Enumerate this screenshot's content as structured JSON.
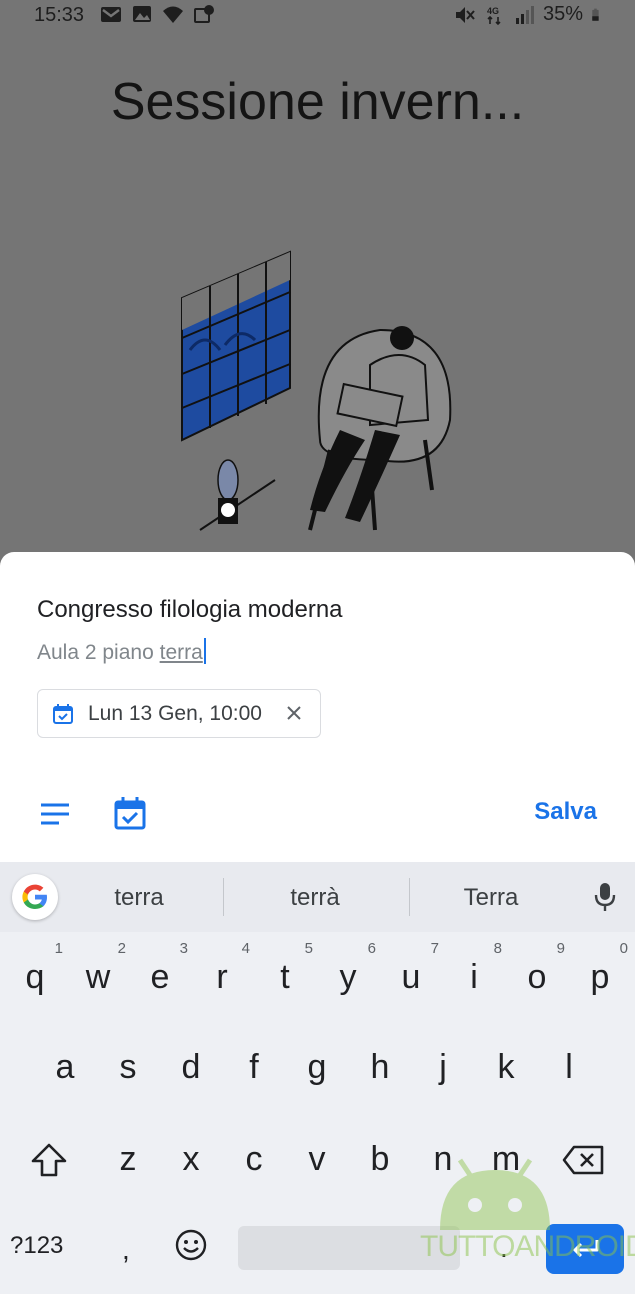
{
  "status_bar": {
    "time": "15:33",
    "battery": "35%",
    "network": "4G"
  },
  "background_app": {
    "title": "Sessione invern..."
  },
  "sheet": {
    "task_title": "Congresso filologia moderna",
    "details_prefix": "Aula 2 piano ",
    "details_underlined": "terra",
    "date_chip": "Lun 13 Gen, 10:00",
    "save_label": "Salva"
  },
  "keyboard": {
    "suggestions": [
      "terra",
      "terrà",
      "Terra"
    ],
    "row1": [
      {
        "key": "q",
        "hint": "1"
      },
      {
        "key": "w",
        "hint": "2"
      },
      {
        "key": "e",
        "hint": "3"
      },
      {
        "key": "r",
        "hint": "4"
      },
      {
        "key": "t",
        "hint": "5"
      },
      {
        "key": "y",
        "hint": "6"
      },
      {
        "key": "u",
        "hint": "7"
      },
      {
        "key": "i",
        "hint": "8"
      },
      {
        "key": "o",
        "hint": "9"
      },
      {
        "key": "p",
        "hint": "0"
      }
    ],
    "row2": [
      "a",
      "s",
      "d",
      "f",
      "g",
      "h",
      "j",
      "k",
      "l"
    ],
    "row3": [
      "z",
      "x",
      "c",
      "v",
      "b",
      "n",
      "m"
    ],
    "symbols_label": "?123",
    "comma": ",",
    "period": "."
  },
  "watermark": "TUTTOANDROID",
  "colors": {
    "accent": "#1a73e8",
    "scrim": "#757575",
    "sheet": "#ffffff",
    "keyboard": "#eef0f4"
  }
}
